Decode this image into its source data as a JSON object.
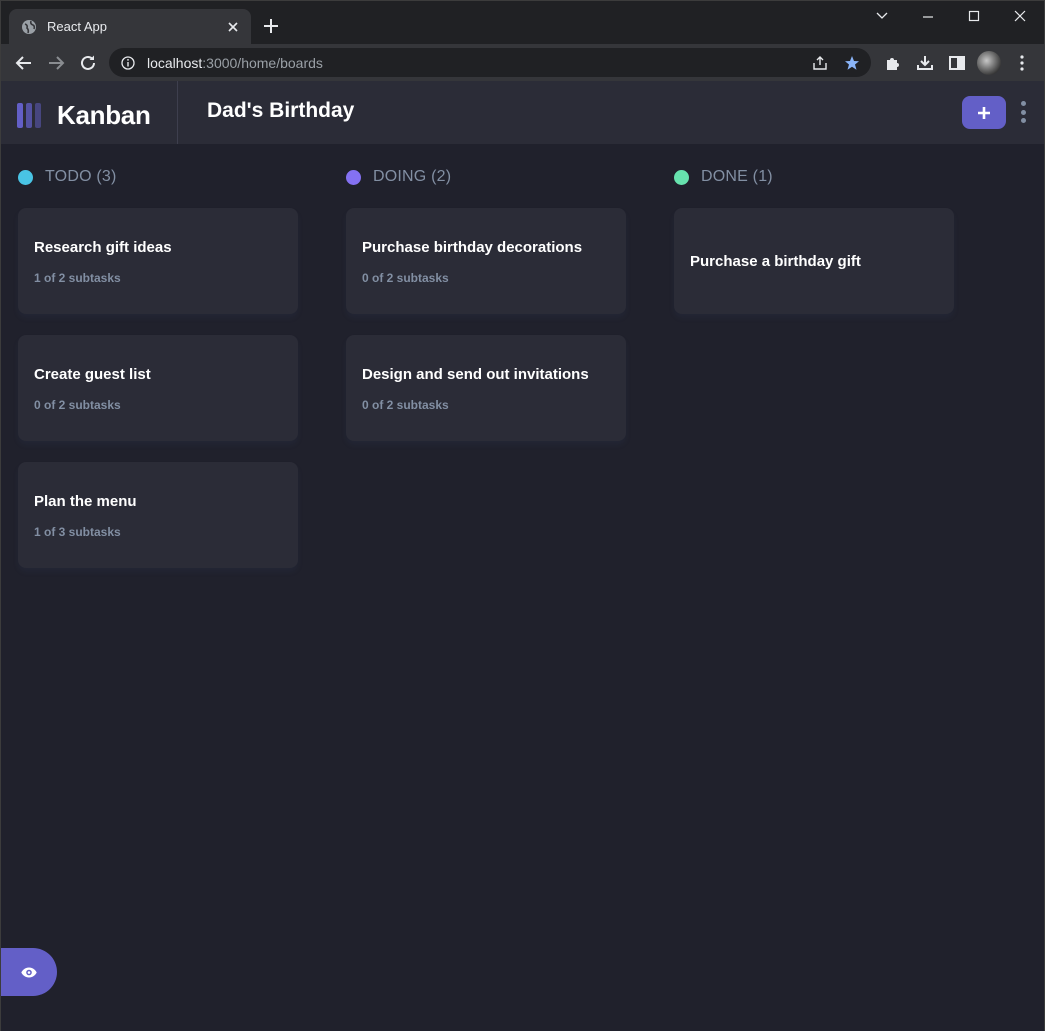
{
  "browser": {
    "tab_title": "React App",
    "url_host": "localhost",
    "url_path": ":3000/home/boards"
  },
  "app": {
    "brand": "Kanban",
    "board_title": "Dad's Birthday",
    "accent_color": "#635fc7"
  },
  "columns": [
    {
      "title": "TODO (3)",
      "dot_color": "#49c4e5",
      "tasks": [
        {
          "title": "Research gift ideas",
          "subtasks": "1 of 2 subtasks"
        },
        {
          "title": "Create guest list",
          "subtasks": "0 of 2 subtasks"
        },
        {
          "title": "Plan the menu",
          "subtasks": "1 of 3 subtasks"
        }
      ]
    },
    {
      "title": "DOING (2)",
      "dot_color": "#8471f2",
      "tasks": [
        {
          "title": "Purchase birthday decorations",
          "subtasks": "0 of 2 subtasks"
        },
        {
          "title": "Design and send out invitations",
          "subtasks": "0 of 2 subtasks"
        }
      ]
    },
    {
      "title": "DONE (1)",
      "dot_color": "#67e2ae",
      "tasks": [
        {
          "title": "Purchase a birthday gift",
          "subtasks": ""
        }
      ]
    }
  ]
}
